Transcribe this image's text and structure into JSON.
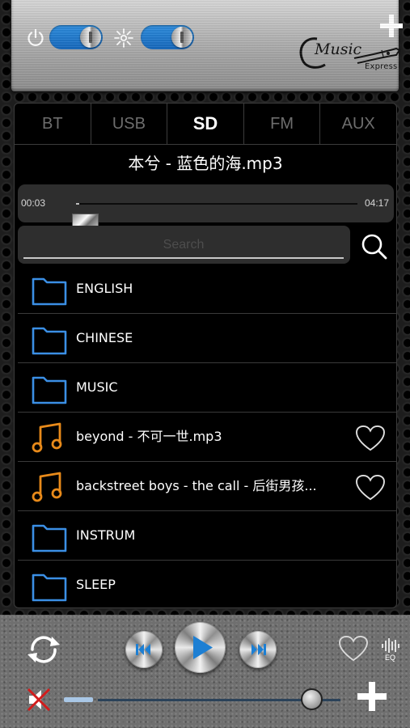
{
  "header": {
    "power_icon": "power-icon",
    "power_toggle_on": true,
    "brightness_icon": "brightness-icon",
    "light_toggle_on": true,
    "add_icon": "plus-icon",
    "logo": {
      "script": "Music",
      "sub": "Express"
    }
  },
  "tabs": [
    {
      "label": "BT",
      "active": false
    },
    {
      "label": "USB",
      "active": false
    },
    {
      "label": "SD",
      "active": true
    },
    {
      "label": "FM",
      "active": false
    },
    {
      "label": "AUX",
      "active": false
    }
  ],
  "player": {
    "track_title": "本兮 - 蓝色的海.mp3",
    "time_current": "00:03",
    "time_total": "04:17",
    "progress_fraction": 0.012
  },
  "search": {
    "placeholder": "Search"
  },
  "files": [
    {
      "type": "folder",
      "name": "ENGLISH",
      "favorite_icon": false
    },
    {
      "type": "folder",
      "name": "CHINESE",
      "favorite_icon": false
    },
    {
      "type": "folder",
      "name": "MUSIC",
      "favorite_icon": false
    },
    {
      "type": "song",
      "name": "beyond - 不可一世.mp3",
      "favorite_icon": true
    },
    {
      "type": "song",
      "name": "backstreet boys - the call - 后街男孩...",
      "favorite_icon": true
    },
    {
      "type": "folder",
      "name": "INSTRUM",
      "favorite_icon": false
    },
    {
      "type": "folder",
      "name": "SLEEP",
      "favorite_icon": false
    }
  ],
  "controls": {
    "repeat_icon": "repeat-icon",
    "prev_icon": "skip-previous-icon",
    "play_icon": "play-icon",
    "next_icon": "skip-next-icon",
    "favorite_icon": "heart-icon",
    "eq_label": "EQ",
    "mute_icon": "mute-icon",
    "volume_fraction": 0.88
  },
  "colors": {
    "accent_blue": "#2f8fe0",
    "folder_blue": "#3b8fe5",
    "note_orange": "#e88a1a",
    "play_blue": "#1d7fd3"
  }
}
